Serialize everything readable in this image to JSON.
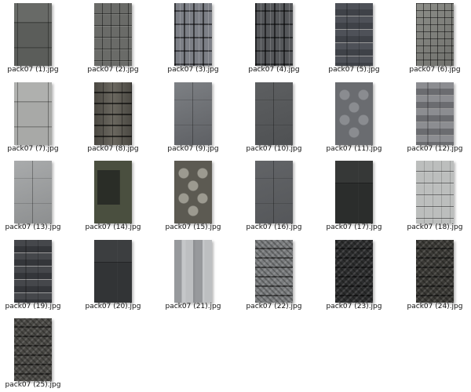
{
  "files": [
    {
      "label": "pack07 (1).jpg",
      "style": "t-plate",
      "c1": "#5b5d5a",
      "c2": "#7a7c78"
    },
    {
      "label": "pack07 (2).jpg",
      "style": "t-panels",
      "c1": "#6a6b68",
      "c2": "#3a3b39"
    },
    {
      "label": "pack07 (3).jpg",
      "style": "t-tech",
      "c1": "#7c7f86",
      "c2": "#4a4d52"
    },
    {
      "label": "pack07 (4).jpg",
      "style": "t-tech",
      "c1": "#55575a",
      "c2": "#2e3033"
    },
    {
      "label": "pack07 (5).jpg",
      "style": "t-blocks",
      "c1": "#3f4248",
      "c2": "#4e5158"
    },
    {
      "label": "pack07 (6).jpg",
      "style": "t-cells",
      "c1": "#6f706c",
      "c2": "#8d8e89"
    },
    {
      "label": "pack07 (7).jpg",
      "style": "t-plate",
      "c1": "#a8a9a7",
      "c2": "#c4c5c3"
    },
    {
      "label": "pack07 (8).jpg",
      "style": "t-bolts",
      "c1": "#4a4842",
      "c2": "#6b6860"
    },
    {
      "label": "pack07 (9).jpg",
      "style": "t-smooth",
      "c1": "#5e6064",
      "c2": "#7d8084"
    },
    {
      "label": "pack07 (10).jpg",
      "style": "t-smooth",
      "c1": "#4f5153",
      "c2": "#5d5f61"
    },
    {
      "label": "pack07 (11).jpg",
      "style": "t-hex",
      "c1": "#6a6c70",
      "c2": "#8a8c90"
    },
    {
      "label": "pack07 (12).jpg",
      "style": "t-blocks",
      "c1": "#6b6c70",
      "c2": "#8c8d91"
    },
    {
      "label": "pack07 (13).jpg",
      "style": "t-smooth",
      "c1": "#8d8f90",
      "c2": "#a9abac"
    },
    {
      "label": "pack07 (14).jpg",
      "style": "t-screen",
      "c1": "#4a4f3f",
      "c2": "#2a2d27"
    },
    {
      "label": "pack07 (15).jpg",
      "style": "t-hex",
      "c1": "#5c5a52",
      "c2": "#9c9a90"
    },
    {
      "label": "pack07 (16).jpg",
      "style": "t-smooth",
      "c1": "#55575a",
      "c2": "#626467"
    },
    {
      "label": "pack07 (17).jpg",
      "style": "t-dark",
      "c1": "#2b2d2c",
      "c2": "#3a3c3b"
    },
    {
      "label": "pack07 (18).jpg",
      "style": "t-panels",
      "c1": "#bcbebd",
      "c2": "#9ea09f"
    },
    {
      "label": "pack07 (19).jpg",
      "style": "t-blocks",
      "c1": "#34363a",
      "c2": "#45474b"
    },
    {
      "label": "pack07 (20).jpg",
      "style": "t-dark",
      "c1": "#323436",
      "c2": "#3e4042"
    },
    {
      "label": "pack07 (21).jpg",
      "style": "t-mosaic",
      "c1": "#8f9194",
      "c2": "#c5c7c9"
    },
    {
      "label": "pack07 (22).jpg",
      "style": "t-noise",
      "c1": "#7b7d7f",
      "c2": "#a0a2a4"
    },
    {
      "label": "pack07 (23).jpg",
      "style": "t-noise",
      "c1": "#2c2d2e",
      "c2": "#494a4b"
    },
    {
      "label": "pack07 (24).jpg",
      "style": "t-noise",
      "c1": "#3b3a36",
      "c2": "#5c5a52"
    },
    {
      "label": "pack07 (25).jpg",
      "style": "t-noise",
      "c1": "#4a4945",
      "c2": "#6e6c66"
    }
  ]
}
